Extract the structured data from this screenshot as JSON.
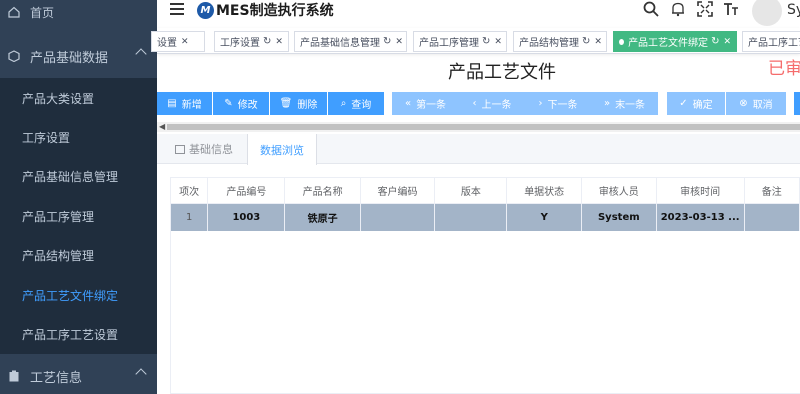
{
  "sidebar": {
    "items": [
      {
        "label": "首页",
        "type": "top"
      },
      {
        "label": "产品基础数据",
        "type": "top",
        "expanded": true
      },
      {
        "label": "产品大类设置",
        "type": "sub"
      },
      {
        "label": "工序设置",
        "type": "sub"
      },
      {
        "label": "产品基础信息管理",
        "type": "sub"
      },
      {
        "label": "产品工序管理",
        "type": "sub"
      },
      {
        "label": "产品结构管理",
        "type": "sub"
      },
      {
        "label": "产品工艺文件绑定",
        "type": "sub",
        "active": true
      },
      {
        "label": "产品工序工艺设置",
        "type": "sub"
      },
      {
        "label": "工艺信息",
        "type": "top"
      }
    ]
  },
  "header": {
    "logo_mark": "M",
    "app_title": "MES制造执行系统",
    "user_name": "Sy"
  },
  "tags": [
    {
      "label": "设置"
    },
    {
      "label": "工序设置"
    },
    {
      "label": "产品基础信息管理"
    },
    {
      "label": "产品工序管理"
    },
    {
      "label": "产品结构管理"
    },
    {
      "label": "产品工艺文件绑定",
      "active": true
    },
    {
      "label": "产品工序工艺"
    }
  ],
  "page": {
    "title": "产品工艺文件",
    "audit_status": "已审"
  },
  "toolbar": {
    "add": "新增",
    "edit": "修改",
    "delete": "删除",
    "query": "查询",
    "first": "第一条",
    "prev": "上一条",
    "next": "下一条",
    "last": "末一条",
    "confirm": "确定",
    "cancel": "取消"
  },
  "tabs": {
    "basic_info": "基础信息",
    "data_browse": "数据浏览"
  },
  "table": {
    "headers": [
      "项次",
      "产品编号",
      "产品名称",
      "客户编码",
      "版本",
      "单据状态",
      "审核人员",
      "审核时间",
      "备注"
    ],
    "rows": [
      [
        "1",
        "1003",
        "铁原子",
        "",
        "",
        "Y",
        "System",
        "2023-03-13 ...",
        ""
      ]
    ]
  },
  "colors": {
    "sidebar_bg": "#304156",
    "sidebar_sub_bg": "#1f2d3d",
    "accent": "#409eff",
    "active_tag": "#42b983",
    "selected_row": "#a3b4c8",
    "audit_red": "#f56c6c"
  }
}
